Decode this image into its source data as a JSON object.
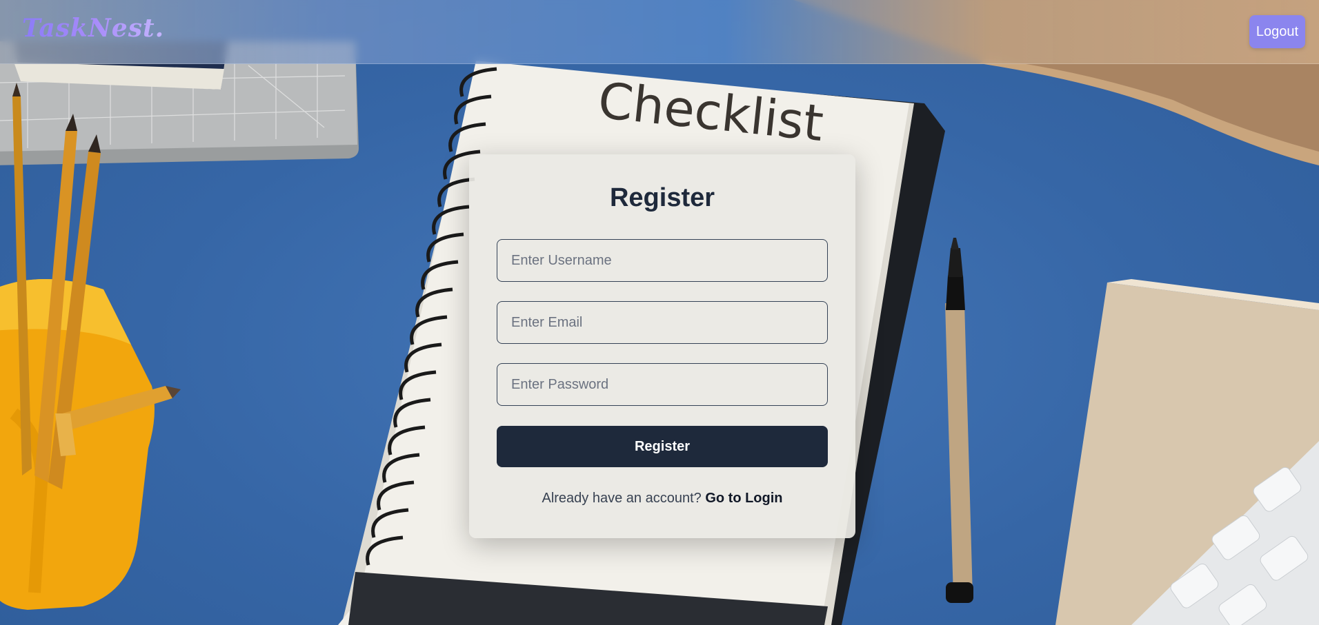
{
  "app": {
    "logo_text": "TaskNest."
  },
  "navbar": {
    "logout_label": "Logout"
  },
  "background": {
    "notebook_heading": "Checklist"
  },
  "register_form": {
    "title": "Register",
    "username_placeholder": "Enter Username",
    "email_placeholder": "Enter Email",
    "password_placeholder": "Enter Password",
    "submit_label": "Register",
    "switch_prompt": "Already have an account?",
    "switch_link": "Go to Login"
  },
  "colors": {
    "accent": "#8b85ee",
    "primary_button": "#1e293b",
    "card_background": "#ebeae4",
    "desk_blue": "#3a6aa8"
  }
}
